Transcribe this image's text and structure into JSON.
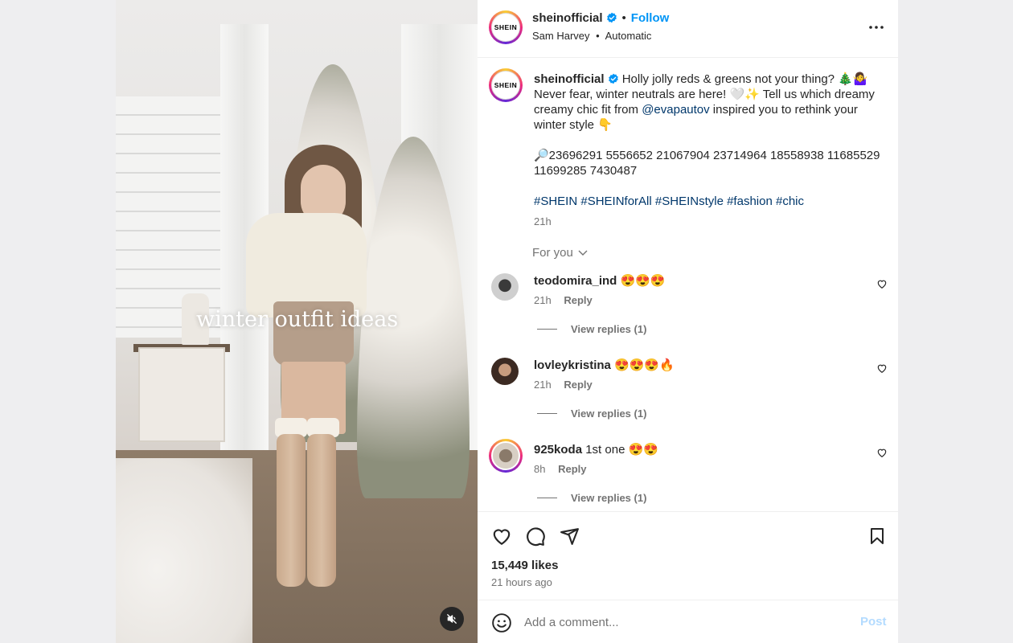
{
  "header": {
    "username": "sheinofficial",
    "avatar_text": "SHEIN",
    "follow_label": "Follow",
    "separator": "•",
    "audio_artist": "Sam Harvey",
    "audio_track": "Automatic"
  },
  "media": {
    "overlay_text": "winter outfit ideas",
    "muted": true
  },
  "caption": {
    "username": "sheinofficial",
    "text_1": " Holly jolly reds & greens not your thing? 🎄🤷‍♀️ Never fear, winter neutrals are here! 🤍✨ Tell us which dreamy creamy chic fit from ",
    "mention": "@evapautov",
    "text_2": " inspired you to rethink your winter style 👇",
    "codes": "🔎23696291 5556652 21067904 23714964 18558938 11685529 11699285 7430487",
    "hashtags": [
      "#SHEIN",
      "#SHEINforAll",
      "#SHEINstyle",
      "#fashion",
      "#chic"
    ],
    "time": "21h"
  },
  "for_you_label": "For you",
  "comments": [
    {
      "username": "teodomira_ind",
      "text": "😍😍😍",
      "time": "21h",
      "reply_label": "Reply",
      "view_replies": "View replies (1)"
    },
    {
      "username": "lovleykristina",
      "text": "😍😍😍🔥",
      "time": "21h",
      "reply_label": "Reply",
      "view_replies": "View replies (1)"
    },
    {
      "username": "925koda",
      "text": "1st one 😍😍",
      "time": "8h",
      "reply_label": "Reply",
      "view_replies": "View replies (1)"
    }
  ],
  "stats": {
    "likes": "15,449 likes",
    "posted": "21 hours ago"
  },
  "comment_box": {
    "placeholder": "Add a comment...",
    "post_label": "Post"
  },
  "icons": {
    "like": "heart-icon",
    "comment": "comment-bubble-icon",
    "share": "paper-plane-icon",
    "save": "bookmark-icon",
    "more": "ellipsis-icon",
    "emoji": "emoji-smiley-icon",
    "mute": "speaker-muted-icon",
    "verified": "verified-badge-icon"
  },
  "colors": {
    "link_blue": "#0095f6",
    "mention_blue": "#00376b",
    "muted_text": "#737373",
    "post_disabled": "#b3dbff"
  }
}
